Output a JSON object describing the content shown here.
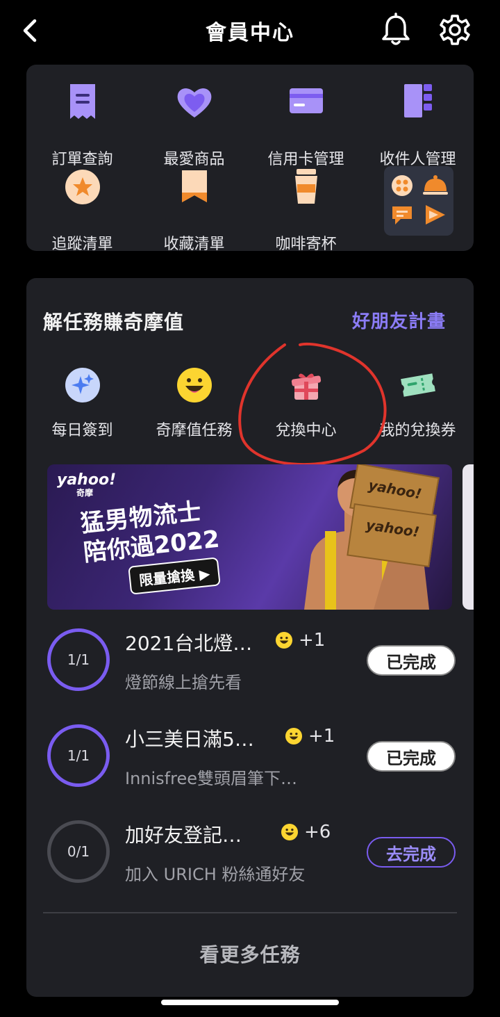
{
  "header": {
    "title": "會員中心"
  },
  "quick_links": [
    {
      "label": "訂單查詢",
      "icon": "receipt-icon"
    },
    {
      "label": "最愛商品",
      "icon": "heart-icon"
    },
    {
      "label": "信用卡管理",
      "icon": "credit-card-icon"
    },
    {
      "label": "收件人管理",
      "icon": "contact-list-icon"
    },
    {
      "label": "追蹤清單",
      "icon": "star-badge-icon"
    },
    {
      "label": "收藏清單",
      "icon": "bookmark-icon"
    },
    {
      "label": "咖啡寄杯",
      "icon": "coffee-cup-icon"
    }
  ],
  "missions": {
    "title": "解任務賺奇摩值",
    "friend_link": "好朋友計畫",
    "tabs": [
      {
        "label": "每日簽到",
        "icon": "sparkle-icon"
      },
      {
        "label": "奇摩值任務",
        "icon": "smiley-icon"
      },
      {
        "label": "兌換中心",
        "icon": "gift-icon"
      },
      {
        "label": "我的兌換券",
        "icon": "ticket-icon"
      }
    ],
    "banner": {
      "brand": "yahoo!",
      "brand_sub": "奇摩",
      "line1": "猛男物流士",
      "line2": "陪你過2022",
      "button": "限量搶換 ▶",
      "box_label": "yahoo!"
    },
    "tasks": [
      {
        "progress": "1/1",
        "name": "2021台北燈…",
        "points": "+1",
        "desc": "燈節線上搶先看",
        "status": "已完成",
        "done": true
      },
      {
        "progress": "1/1",
        "name": "小三美日滿5…",
        "points": "+1",
        "desc": "Innisfree雙頭眉筆下…",
        "status": "已完成",
        "done": true
      },
      {
        "progress": "0/1",
        "name": "加好友登記…",
        "points": "+6",
        "desc": "加入 URICH 粉絲通好友",
        "status": "去完成",
        "done": false
      }
    ],
    "more": "看更多任務"
  },
  "colors": {
    "accent": "#8b7cf6",
    "card": "#1f2025",
    "annotation": "#e0342c"
  }
}
